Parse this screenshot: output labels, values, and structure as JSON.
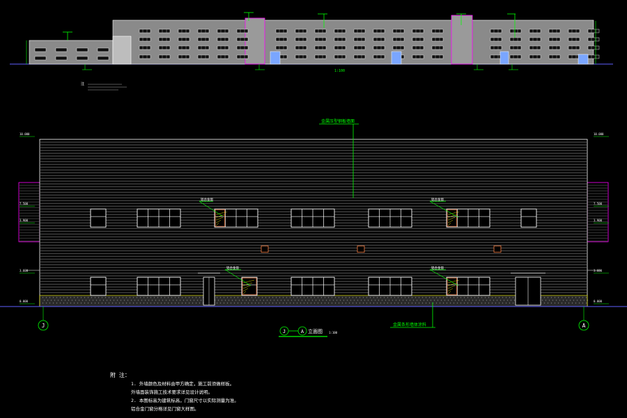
{
  "colors": {
    "background": "#000000",
    "outline": "#ffffff",
    "leader": "#00ff00",
    "cladding_stroke": "#d8d8d8",
    "facade_fill": "#8a8a8a",
    "window_fill": "#101010",
    "accent_magenta": "#ff00ff",
    "accent_yellow": "#ffff00",
    "accent_orange": "#ff8040",
    "axis": "#00ff00",
    "ground": "#6060ff"
  },
  "top_elevation": {
    "note_marker": "注",
    "scale_label": "1:100"
  },
  "main_elevation": {
    "roof_callout": "金属压型钢板墙面",
    "base_callout": "金属条形墙体涂料",
    "window_callout_upper_1": "铝合金窗",
    "window_callout_upper_2": "铝合金窗",
    "window_callout_lower_1": "铝合金窗",
    "window_callout_lower_2": "铝合金窗",
    "axis_left": "J",
    "axis_right": "A",
    "title_axis_from": "J",
    "title_axis_to": "A",
    "title_suffix": "立面图",
    "title_scale": "1:100",
    "levels_left": [
      "10.000",
      "7.500",
      "3.900",
      "3.600",
      "0.000"
    ],
    "levels_right": [
      "10.000",
      "7.500",
      "3.900",
      "3.600",
      "0.000"
    ]
  },
  "notes": {
    "heading": "附 注：",
    "items": [
      "1. 外墙颜色及材料由甲方确定，施工前须做样板。",
      "   外墙面装饰施工技术要求详见设计说明。",
      "2. 本图标高为建筑标高，门窗尺寸以实际测量为准。",
      "   铝合金门窗分格详见门窗大样图。"
    ]
  }
}
